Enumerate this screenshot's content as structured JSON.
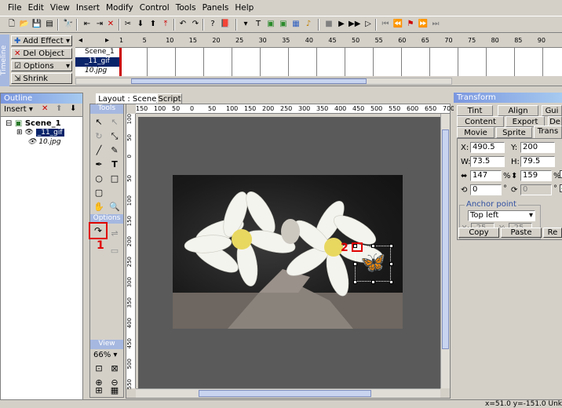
{
  "menu": [
    "File",
    "Edit",
    "View",
    "Insert",
    "Modify",
    "Control",
    "Tools",
    "Panels",
    "Help"
  ],
  "timeline": {
    "buttons": [
      "Add Effect",
      "Del Object",
      "Options",
      "Shrink"
    ],
    "vertical_label": "Timeline",
    "rows": [
      "Scene_1",
      "_11_gif",
      "10.jpg"
    ],
    "frame_ticks": [
      "1",
      "5",
      "10",
      "15",
      "20",
      "25",
      "30",
      "35",
      "40",
      "45",
      "50",
      "55",
      "60",
      "65",
      "70",
      "75",
      "80",
      "85",
      "90"
    ]
  },
  "outline": {
    "title": "Outline",
    "insert_label": "Insert",
    "tree": [
      "Scene_1",
      "_11_gif",
      "10.jpg"
    ]
  },
  "tools": {
    "title": "Tools",
    "options_title": "Options",
    "view_title": "View",
    "zoom": "66%"
  },
  "stage": {
    "tab_layout": "Layout : Scene_1",
    "tab_script": "Script",
    "ruler_h": [
      "150",
      "100",
      "50",
      "0",
      "50",
      "100",
      "150",
      "200",
      "250",
      "300",
      "350",
      "400",
      "450",
      "500",
      "550",
      "600",
      "650",
      "700",
      "750"
    ],
    "ruler_v": [
      "100",
      "50",
      "0",
      "50",
      "100",
      "150",
      "200",
      "250",
      "300",
      "350",
      "400",
      "450",
      "500",
      "550"
    ],
    "marker_1": "1",
    "marker_2": "2"
  },
  "transform": {
    "title": "Transform",
    "tabs_row1": [
      "Tint",
      "Align",
      "Gui"
    ],
    "tabs_row2": [
      "Content",
      "Export",
      "De"
    ],
    "tabs_row3": [
      "Movie",
      "Sprite",
      "Trans"
    ],
    "x_label": "X:",
    "x": "490.5",
    "y_label": "Y:",
    "y": "200",
    "w_label": "W:",
    "w": "73.5",
    "h_label": "H:",
    "h": "79.5",
    "sx": "147",
    "sy": "159",
    "pct": "%",
    "rot": "0",
    "skew": "0",
    "deg": "°",
    "anchor_title": "Anchor point",
    "anchor_value": "Top left",
    "ax_label": "X:",
    "ax": "-25",
    "ay_label": "Y:",
    "ay": "-25",
    "copy": "Copy",
    "paste": "Paste",
    "reset": "Re"
  },
  "status": "x=51.0 y=-151.0  Unkno"
}
